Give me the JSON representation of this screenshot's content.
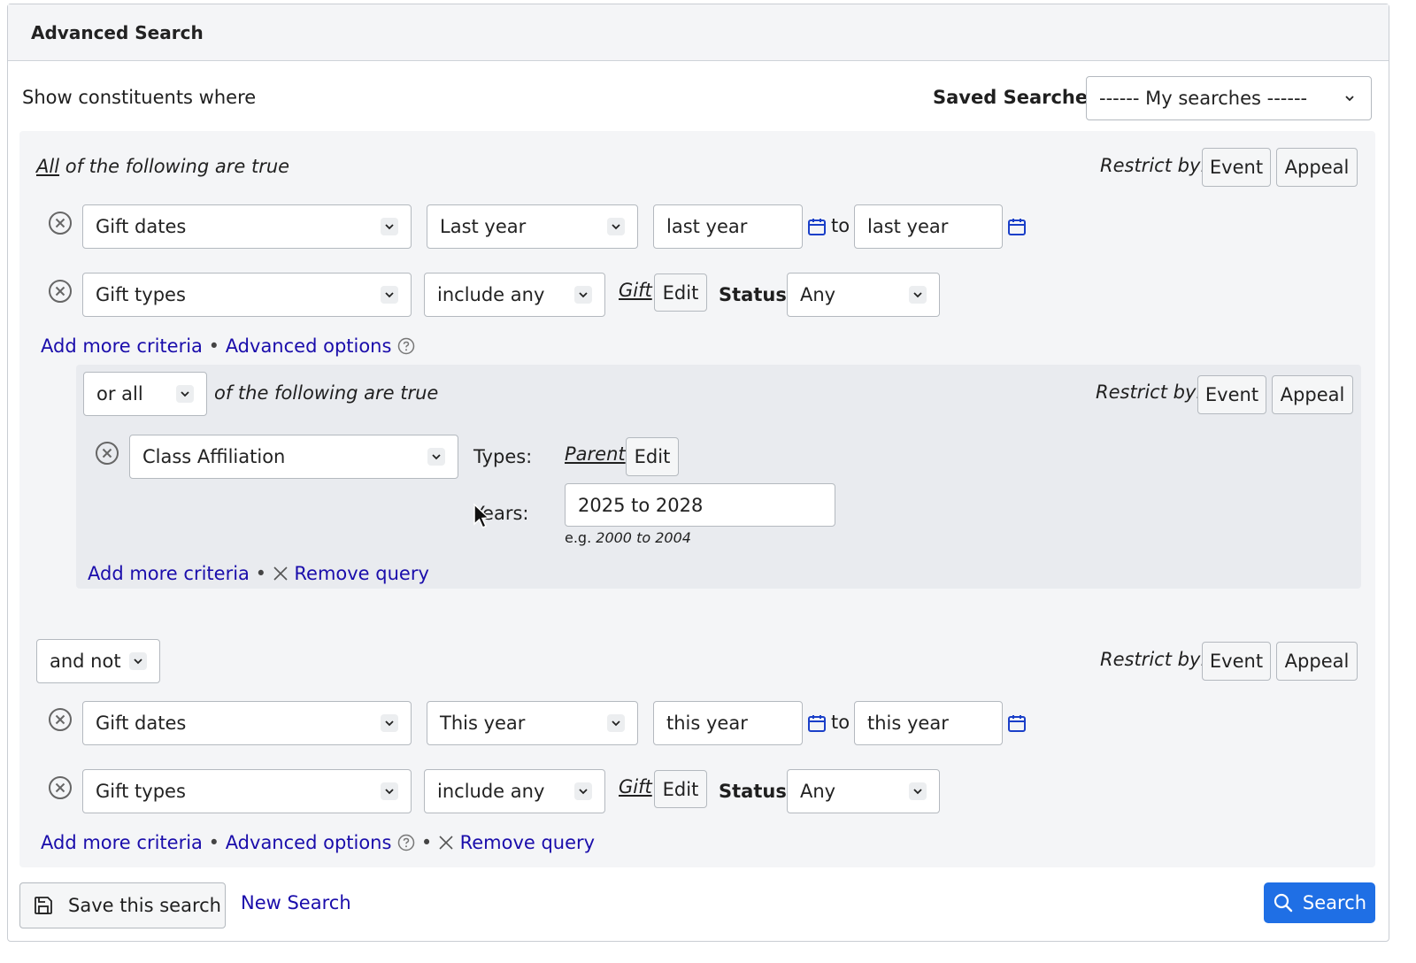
{
  "header": {
    "title": "Advanced Search"
  },
  "intro": {
    "label": "Show constituents where"
  },
  "saved": {
    "label": "Saved Searches:",
    "value": "------ My searches ------"
  },
  "restrict_label": "Restrict by:",
  "restrict_event": "Event",
  "restrict_appeal": "Appeal",
  "group1": {
    "quant": "All",
    "rest": " of the following are true",
    "row1": {
      "field": "Gift dates",
      "range": "Last year",
      "from": "last year",
      "to_label": "to",
      "to": "last year"
    },
    "row2": {
      "field": "Gift types",
      "op": "include any",
      "type_link": "Gift",
      "edit": "Edit",
      "status_label": "Status:",
      "status": "Any"
    },
    "add": "Add more criteria",
    "sep": "•",
    "advanced": "Advanced options"
  },
  "subgroup": {
    "quant": "or all",
    "rest": "of the following are true",
    "row": {
      "field": "Class Affiliation",
      "types_label": "Types:",
      "type_link": "Parent",
      "edit": "Edit",
      "years_label": "Years:",
      "years": "2025 to 2028",
      "hint_prefix": "e.g.",
      "hint_example": "2000 to 2004"
    },
    "add": "Add more criteria",
    "sep": "•",
    "remove": "Remove query"
  },
  "group2": {
    "quant": "and not",
    "row1": {
      "field": "Gift dates",
      "range": "This year",
      "from": "this year",
      "to_label": "to",
      "to": "this year"
    },
    "row2": {
      "field": "Gift types",
      "op": "include any",
      "type_link": "Gift",
      "edit": "Edit",
      "status_label": "Status:",
      "status": "Any"
    },
    "add": "Add more criteria",
    "sep": "•",
    "advanced": "Advanced options",
    "remove": "Remove query"
  },
  "footer": {
    "save": "Save this search",
    "new": "New Search",
    "search": "Search"
  },
  "colors": {
    "accent": "#1f6fe5",
    "link": "#1a0dab",
    "panel_bg": "#f4f5f7",
    "subgroup_bg": "#e9ebef"
  },
  "icons": [
    "remove-circle-icon",
    "chevron-down-icon",
    "calendar-icon",
    "help-icon",
    "close-icon",
    "save-icon",
    "search-icon",
    "mouse-cursor-icon"
  ]
}
